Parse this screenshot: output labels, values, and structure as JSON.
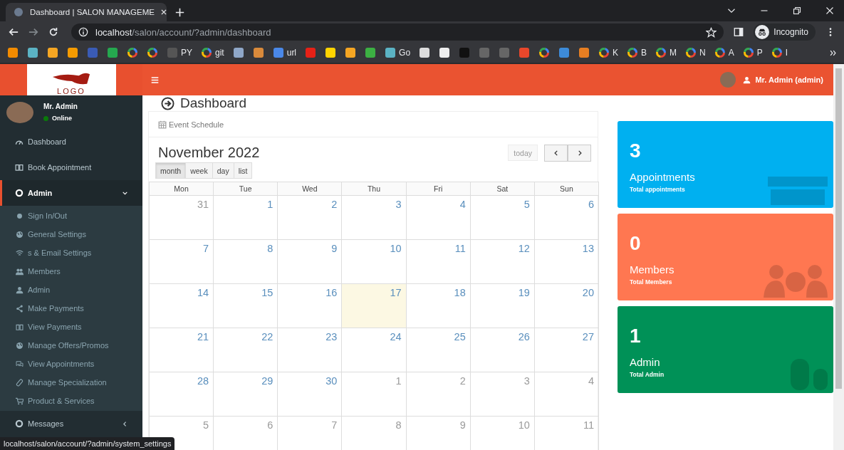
{
  "browser": {
    "tab_title": "Dashboard | SALON MANAGEME",
    "url_host": "localhost",
    "url_path": "/salon/account/?admin/dashboard",
    "profile": "Incognito",
    "bookmarks": [
      {
        "kind": "site",
        "color": "#f28b00"
      },
      {
        "kind": "site",
        "color": "#5bb3c4"
      },
      {
        "kind": "site",
        "color": "#f5a623"
      },
      {
        "kind": "site",
        "color": "#f59b00"
      },
      {
        "kind": "site",
        "color": "#3a5bb5"
      },
      {
        "kind": "site",
        "color": "#25a84f"
      },
      {
        "kind": "google"
      },
      {
        "kind": "google"
      },
      {
        "kind": "site",
        "color": "#555555",
        "label": "PY"
      },
      {
        "kind": "google",
        "label": "git"
      },
      {
        "kind": "site",
        "color": "#8fa7c8"
      },
      {
        "kind": "site",
        "color": "#d98a3b"
      },
      {
        "kind": "site",
        "color": "#4a88e8",
        "label": "url"
      },
      {
        "kind": "site",
        "color": "#e62117"
      },
      {
        "kind": "site",
        "color": "#ffd400"
      },
      {
        "kind": "site",
        "color": "#f5a623"
      },
      {
        "kind": "site",
        "color": "#3cb043"
      },
      {
        "kind": "site",
        "color": "#5bb3c4",
        "label": "Go"
      },
      {
        "kind": "site",
        "color": "#dddddd"
      },
      {
        "kind": "site",
        "color": "#eeeeee"
      },
      {
        "kind": "site",
        "color": "#111111"
      },
      {
        "kind": "site",
        "color": "#666666"
      },
      {
        "kind": "site",
        "color": "#666666"
      },
      {
        "kind": "site",
        "color": "#e8472b"
      },
      {
        "kind": "google"
      },
      {
        "kind": "site",
        "color": "#3d8bd9"
      },
      {
        "kind": "site",
        "color": "#e67e22"
      },
      {
        "kind": "google",
        "label": "K"
      },
      {
        "kind": "google",
        "label": "B"
      },
      {
        "kind": "google",
        "label": "M"
      },
      {
        "kind": "google",
        "label": "N"
      },
      {
        "kind": "google",
        "label": "A"
      },
      {
        "kind": "google",
        "label": "P"
      },
      {
        "kind": "google",
        "label": "I"
      }
    ]
  },
  "header": {
    "logo_text": "LOGO",
    "user": "Mr. Admin (admin)"
  },
  "sidebar": {
    "user": {
      "name": "Mr. Admin",
      "status": "Online"
    },
    "items": [
      {
        "label": "Dashboard",
        "selected": false
      },
      {
        "label": "Book Appointment",
        "selected": false
      },
      {
        "label": "Admin",
        "selected": true,
        "expanded": true,
        "children": [
          {
            "label": "Sign In/Out"
          },
          {
            "label": "General Settings"
          },
          {
            "label": "s & Email Settings"
          },
          {
            "label": "Members"
          },
          {
            "label": "Admin"
          },
          {
            "label": "Make Payments"
          },
          {
            "label": "View Payments"
          },
          {
            "label": "Manage Offers/Promos"
          },
          {
            "label": "View Appointments"
          },
          {
            "label": "Manage Specialization"
          },
          {
            "label": "Product & Services"
          }
        ]
      },
      {
        "label": "Messages",
        "selected": false,
        "expanded": false
      }
    ]
  },
  "page": {
    "title": "Dashboard"
  },
  "calendar": {
    "panel_title": "Event Schedule",
    "month": "November 2022",
    "today_button": {
      "label": "today",
      "disabled": true
    },
    "views": [
      {
        "label": "month",
        "selected": true
      },
      {
        "label": "week",
        "selected": false
      },
      {
        "label": "day",
        "selected": false
      },
      {
        "label": "list",
        "selected": false
      }
    ],
    "weekdays": [
      "Mon",
      "Tue",
      "Wed",
      "Thu",
      "Fri",
      "Sat",
      "Sun"
    ],
    "weeks": [
      [
        {
          "day": "31",
          "other_month": true,
          "today": false
        },
        {
          "day": "1",
          "other_month": false,
          "today": false
        },
        {
          "day": "2",
          "other_month": false,
          "today": false
        },
        {
          "day": "3",
          "other_month": false,
          "today": false
        },
        {
          "day": "4",
          "other_month": false,
          "today": false
        },
        {
          "day": "5",
          "other_month": false,
          "today": false
        },
        {
          "day": "6",
          "other_month": false,
          "today": false
        }
      ],
      [
        {
          "day": "7",
          "other_month": false,
          "today": false
        },
        {
          "day": "8",
          "other_month": false,
          "today": false
        },
        {
          "day": "9",
          "other_month": false,
          "today": false
        },
        {
          "day": "10",
          "other_month": false,
          "today": false
        },
        {
          "day": "11",
          "other_month": false,
          "today": false
        },
        {
          "day": "12",
          "other_month": false,
          "today": false
        },
        {
          "day": "13",
          "other_month": false,
          "today": false
        }
      ],
      [
        {
          "day": "14",
          "other_month": false,
          "today": false
        },
        {
          "day": "15",
          "other_month": false,
          "today": false
        },
        {
          "day": "16",
          "other_month": false,
          "today": false
        },
        {
          "day": "17",
          "other_month": false,
          "today": true
        },
        {
          "day": "18",
          "other_month": false,
          "today": false
        },
        {
          "day": "19",
          "other_month": false,
          "today": false
        },
        {
          "day": "20",
          "other_month": false,
          "today": false
        }
      ],
      [
        {
          "day": "21",
          "other_month": false,
          "today": false
        },
        {
          "day": "22",
          "other_month": false,
          "today": false
        },
        {
          "day": "23",
          "other_month": false,
          "today": false
        },
        {
          "day": "24",
          "other_month": false,
          "today": false
        },
        {
          "day": "25",
          "other_month": false,
          "today": false
        },
        {
          "day": "26",
          "other_month": false,
          "today": false
        },
        {
          "day": "27",
          "other_month": false,
          "today": false
        }
      ],
      [
        {
          "day": "28",
          "other_month": false,
          "today": false
        },
        {
          "day": "29",
          "other_month": false,
          "today": false
        },
        {
          "day": "30",
          "other_month": false,
          "today": false
        },
        {
          "day": "1",
          "other_month": true,
          "today": false
        },
        {
          "day": "2",
          "other_month": true,
          "today": false
        },
        {
          "day": "3",
          "other_month": true,
          "today": false
        },
        {
          "day": "4",
          "other_month": true,
          "today": false
        }
      ],
      [
        {
          "day": "5",
          "other_month": true,
          "today": false
        },
        {
          "day": "6",
          "other_month": true,
          "today": false
        },
        {
          "day": "7",
          "other_month": true,
          "today": false
        },
        {
          "day": "8",
          "other_month": true,
          "today": false
        },
        {
          "day": "9",
          "other_month": true,
          "today": false
        },
        {
          "day": "10",
          "other_month": true,
          "today": false
        },
        {
          "day": "11",
          "other_month": true,
          "today": false
        }
      ]
    ]
  },
  "stats": [
    {
      "value": "3",
      "title": "Appointments",
      "subtitle": "Total appointments",
      "color": "#00b0f0"
    },
    {
      "value": "0",
      "title": "Members",
      "subtitle": "Total Members",
      "color": "#ff7751"
    },
    {
      "value": "1",
      "title": "Admin",
      "subtitle": "Total Admin",
      "color": "#009157"
    }
  ],
  "status_link": "localhost/salon/account/?admin/system_settings"
}
